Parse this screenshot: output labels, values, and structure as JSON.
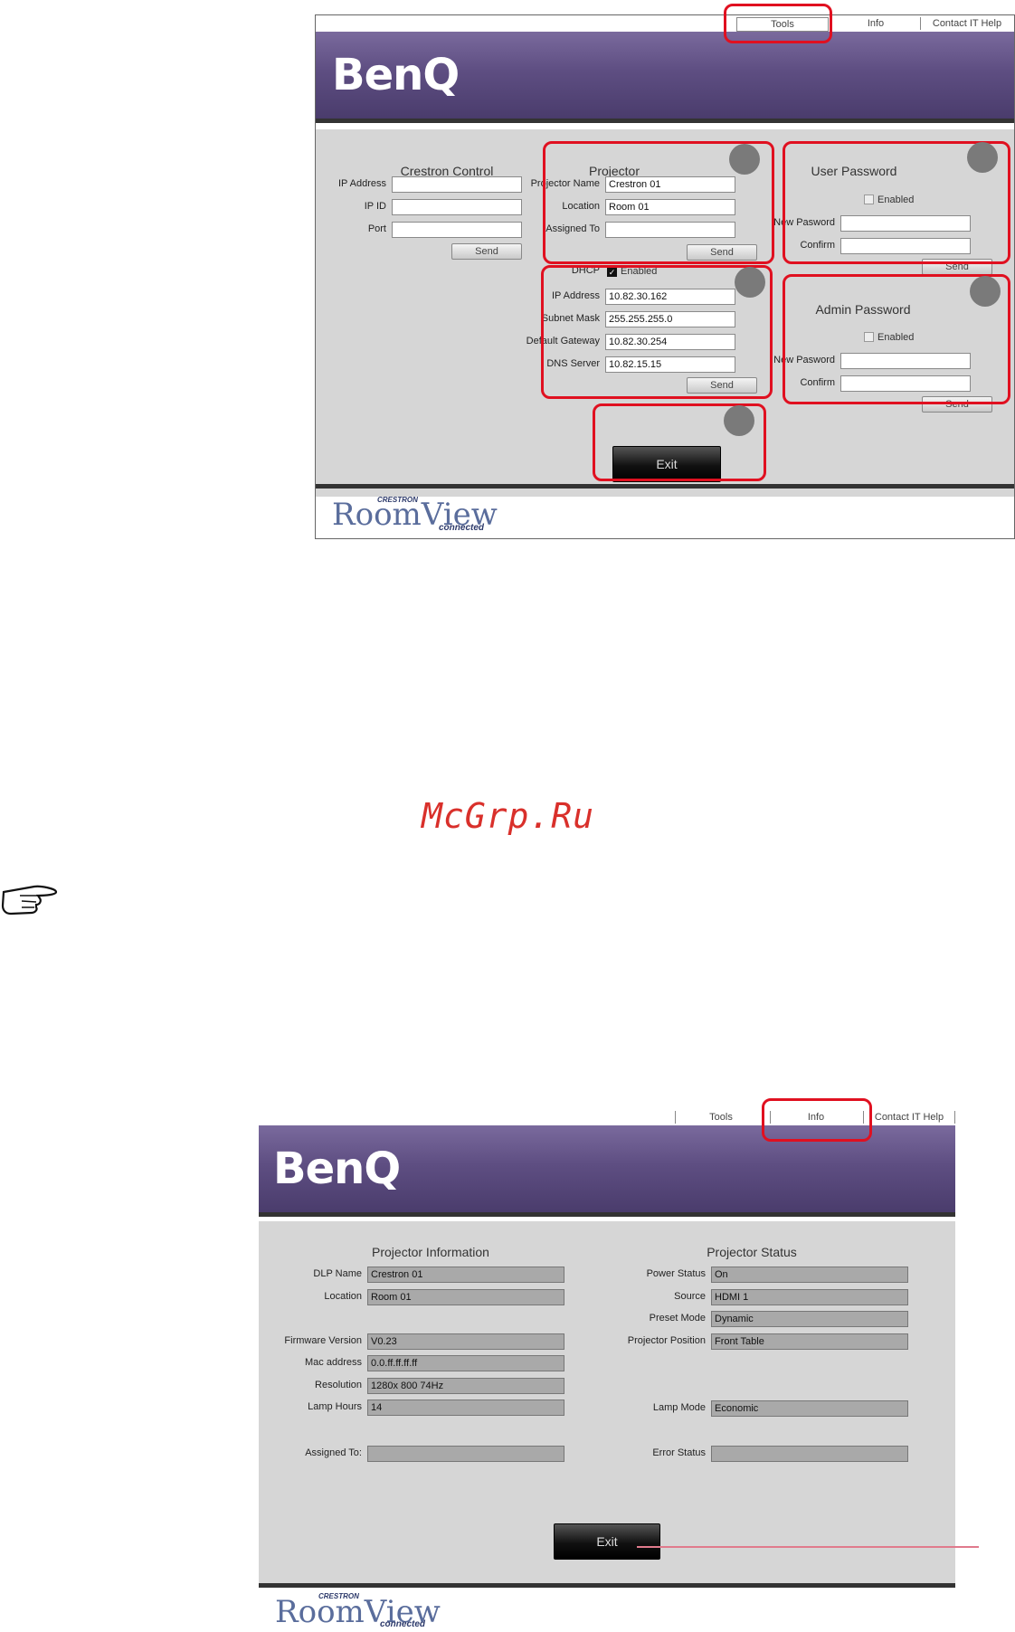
{
  "watermark": "McGrp.Ru",
  "tools_screen": {
    "nav": {
      "tools": "Tools",
      "info": "Info",
      "help": "Contact IT Help"
    },
    "logo": "BenQ",
    "footer": {
      "brand": "RoomView",
      "crestron": "CRESTRON",
      "connected": "connected"
    },
    "crestron_control": {
      "title": "Crestron Control",
      "ip_address_label": "IP Address",
      "ip_id_label": "IP ID",
      "port_label": "Port",
      "ip_address": "",
      "ip_id": "",
      "port": "",
      "send": "Send"
    },
    "projector": {
      "title": "Projector",
      "name_label": "Projector Name",
      "location_label": "Location",
      "assigned_label": "Assigned To",
      "name": "Crestron 01",
      "location": "Room 01",
      "assigned": "",
      "send": "Send"
    },
    "network": {
      "dhcp_label": "DHCP",
      "dhcp_enabled_label": "Enabled",
      "dhcp_checked": true,
      "ip_label": "IP Address",
      "subnet_label": "Subnet Mask",
      "gateway_label": "Default Gateway",
      "dns_label": "DNS Server",
      "ip": "10.82.30.162",
      "subnet": "255.255.255.0",
      "gateway": "10.82.30.254",
      "dns": "10.82.15.15",
      "send": "Send"
    },
    "user_password": {
      "title": "User Password",
      "enabled_label": "Enabled",
      "new_label": "New Pasword",
      "confirm_label": "Confirm",
      "send": "Send"
    },
    "admin_password": {
      "title": "Admin Password",
      "enabled_label": "Enabled",
      "new_label": "New Pasword",
      "confirm_label": "Confirm",
      "send": "Send"
    },
    "exit": "Exit"
  },
  "info_screen": {
    "nav": {
      "tools": "Tools",
      "info": "Info",
      "help": "Contact IT Help"
    },
    "logo": "BenQ",
    "footer": {
      "brand": "RoomView",
      "crestron": "CRESTRON",
      "connected": "connected"
    },
    "projector_information": {
      "title": "Projector Information",
      "dlp_name_label": "DLP Name",
      "dlp_name": "Crestron 01",
      "location_label": "Location",
      "location": "Room 01",
      "firmware_label": "Firmware Version",
      "firmware": "V0.23",
      "mac_label": "Mac address",
      "mac": "0.0.ff.ff.ff.ff",
      "resolution_label": "Resolution",
      "resolution": "1280x 800  74Hz",
      "lamp_hours_label": "Lamp Hours",
      "lamp_hours": "14",
      "assigned_label": "Assigned To:",
      "assigned": ""
    },
    "projector_status": {
      "title": "Projector Status",
      "power_label": "Power Status",
      "power": "On",
      "source_label": "Source",
      "source": "HDMI 1",
      "preset_label": "Preset Mode",
      "preset": "Dynamic",
      "position_label": "Projector Position",
      "position": "Front Table",
      "lamp_mode_label": "Lamp Mode",
      "lamp_mode": "Economic",
      "error_label": "Error Status",
      "error": ""
    },
    "exit": "Exit"
  },
  "colors": {
    "banner": "#5e4e82",
    "panel": "#d6d6d6",
    "callout": "#e01020",
    "watermark": "#d9302b"
  }
}
